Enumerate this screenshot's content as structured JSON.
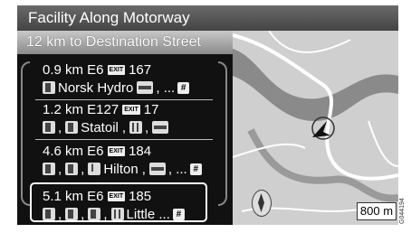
{
  "title": "Facility Along Motorway",
  "subtitle": "12 km to Destination Street",
  "exit_label": "EXIT",
  "more_label": "#",
  "entries": [
    {
      "distance": "0.9 km E6",
      "exit": "167",
      "line2": "Norsk Hydro",
      "suffix": ", ..."
    },
    {
      "distance": "1.2 km E127",
      "exit": "17",
      "line2": "Statoil",
      "suffix": ""
    },
    {
      "distance": "4.6 km E6",
      "exit": "184",
      "line2": "Hilton",
      "suffix": ", ..."
    },
    {
      "distance": "5.1 km E6",
      "exit": "185",
      "line2": "Little ...",
      "suffix": ""
    }
  ],
  "scale": "800 m",
  "image_id": "G044194",
  "colors": {
    "title_bg": "#555555",
    "list_bg": "#111111",
    "map_bg": "#cfcfcf",
    "road": "#ffffff",
    "water": "#777777"
  }
}
